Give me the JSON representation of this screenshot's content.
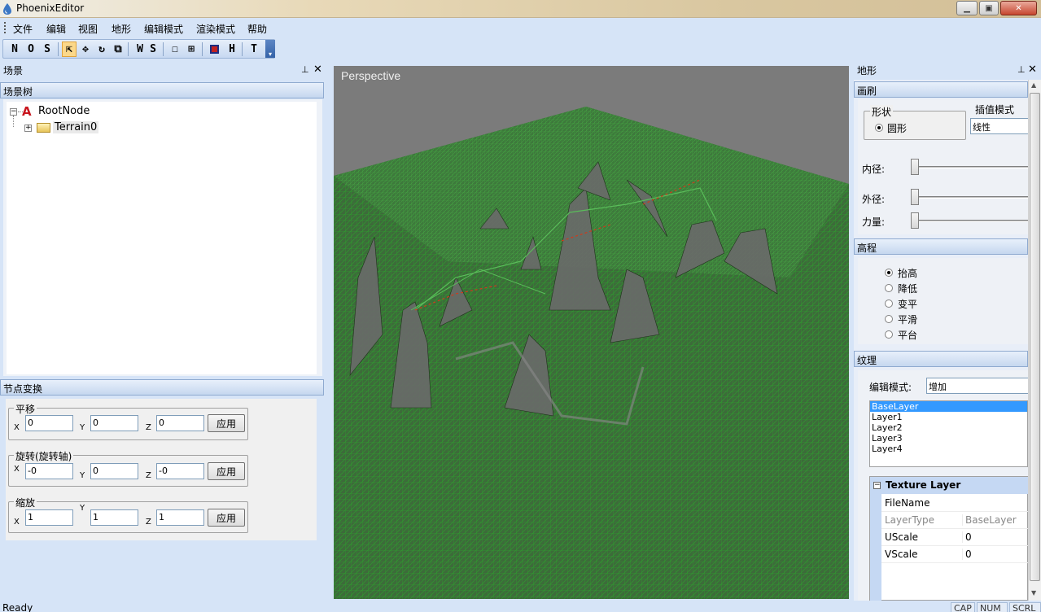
{
  "window": {
    "title": "PhoenixEditor"
  },
  "menu": [
    "文件",
    "编辑",
    "视图",
    "地形",
    "编辑模式",
    "渲染模式",
    "帮助"
  ],
  "toolbar": {
    "n": "N",
    "o": "O",
    "s": "S",
    "ws_w": "W",
    "ws_s": "S",
    "h": "H",
    "t": "T"
  },
  "scene_panel": {
    "title": "场景",
    "tree_header": "场景树",
    "tree": {
      "root": "RootNode",
      "child": "Terrain0"
    },
    "transform_header": "节点变换",
    "translate": {
      "legend": "平移",
      "x": "0",
      "y": "0",
      "z": "0",
      "apply": "应用"
    },
    "rotate": {
      "legend": "旋转(旋转轴)",
      "x": "-0",
      "y": "0",
      "z": "-0",
      "apply": "应用"
    },
    "scale": {
      "legend": "缩放",
      "x": "1",
      "y": "1",
      "z": "1",
      "apply": "应用"
    },
    "axis": {
      "x": "X",
      "y": "Y",
      "z": "Z"
    }
  },
  "viewport": {
    "label": "Perspective"
  },
  "terrain_panel": {
    "title": "地形",
    "brush_header": "画刷",
    "shape_legend": "形状",
    "shape_option": "圆形",
    "interp_label": "插值模式",
    "interp_value": "线性",
    "inner_label": "内径:",
    "outer_label": "外径:",
    "strength_label": "力量:",
    "height_header": "高程",
    "height_modes": [
      "抬高",
      "降低",
      "变平",
      "平滑",
      "平台"
    ],
    "height_selected": 0,
    "texture_header": "纹理",
    "edit_mode_label": "编辑模式:",
    "edit_mode_value": "增加",
    "layers": [
      "BaseLayer",
      "Layer1",
      "Layer2",
      "Layer3",
      "Layer4"
    ],
    "layer_selected": 0,
    "props_header": "Texture Layer",
    "props": [
      {
        "key": "FileName",
        "value": ""
      },
      {
        "key": "LayerType",
        "value": "BaseLayer"
      },
      {
        "key": "UScale",
        "value": "0"
      },
      {
        "key": "VScale",
        "value": "0"
      }
    ]
  },
  "status": {
    "text": "Ready",
    "cap": "CAP",
    "num": "NUM",
    "scrl": "SCRL"
  },
  "colors": {
    "accent": "#3399ff",
    "terrain_green": "#2f7a2f",
    "viewport_bg": "#7b7b7b"
  }
}
